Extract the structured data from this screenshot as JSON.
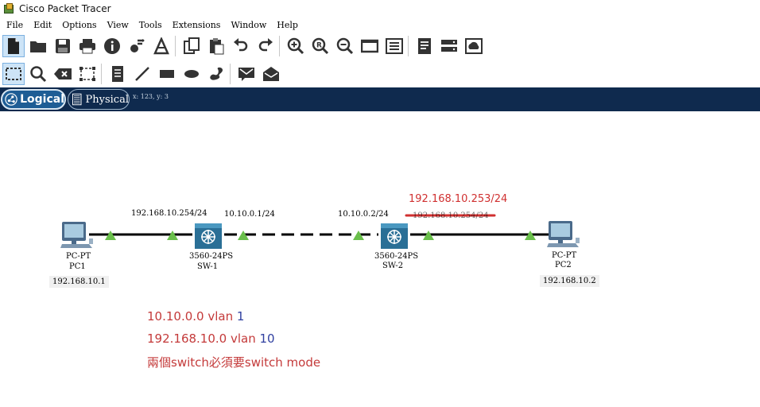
{
  "window": {
    "title": "Cisco Packet Tracer"
  },
  "menu": [
    "File",
    "Edit",
    "Options",
    "View",
    "Tools",
    "Extensions",
    "Window",
    "Help"
  ],
  "toolbar_main": [
    "new-file-icon",
    "open-folder-icon",
    "save-icon",
    "print-icon",
    "info-icon",
    "network-wizard-icon",
    "activity-wizard-icon",
    "copy-icon",
    "paste-icon",
    "undo-icon",
    "redo-icon",
    "zoom-in-icon",
    "zoom-reset-icon",
    "zoom-out-icon",
    "drawing-palette-icon",
    "custom-device-dialog-icon",
    "view-command-log-icon",
    "ipc-icon",
    "cluster-icon"
  ],
  "toolbar_tools": [
    "select-icon",
    "inspect-icon",
    "delete-icon",
    "resize-shape-icon",
    "place-note-icon",
    "draw-line-icon",
    "draw-rectangle-icon",
    "draw-ellipse-icon",
    "freeform-icon",
    "add-simple-pdu-icon",
    "add-complex-pdu-icon"
  ],
  "tabs": {
    "logical": "Logical",
    "physical": "Physical",
    "coords": "x: 123, y: 3"
  },
  "devices": {
    "pc1": {
      "model": "PC-PT",
      "name": "PC1",
      "ip": "192.168.10.1"
    },
    "sw1": {
      "model": "3560-24PS",
      "name": "SW-1"
    },
    "sw2": {
      "model": "3560-24PS",
      "name": "SW-2"
    },
    "pc2": {
      "model": "PC-PT",
      "name": "PC2",
      "ip": "192.168.10.2"
    }
  },
  "link_labels": {
    "sw1_left": "192.168.10.254/24",
    "sw1_right": "10.10.0.1/24",
    "sw2_left": "10.10.0.2/24",
    "sw2_right_struck": "192.168.10.254/24",
    "sw2_right_new": "192.168.10.253/24"
  },
  "notes": {
    "line1_text": "10.10.0.0 vlan ",
    "line1_num": "1",
    "line2_text": "192.168.10.0 vlan ",
    "line2_num": "10",
    "line3": "兩個switch必須要switch mode"
  },
  "colors": {
    "tab_bar": "#0f2a4e",
    "note_red": "#c43a3a",
    "note_blue": "#3040a0",
    "link_light": "#6abf4b",
    "annotation_red": "#d03030"
  }
}
